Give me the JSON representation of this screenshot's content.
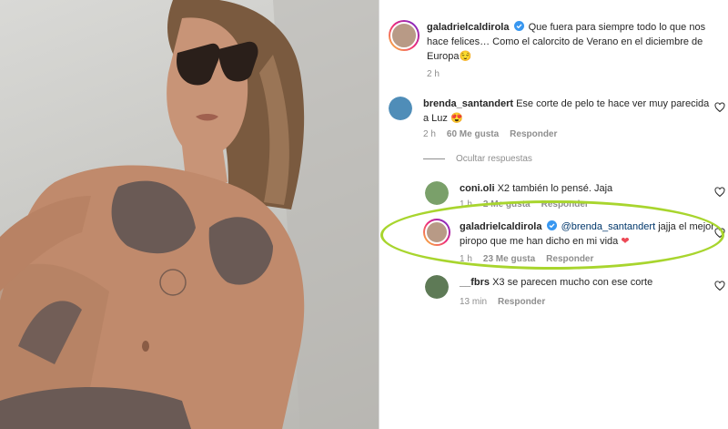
{
  "post": {
    "caption": {
      "username": "galadrielcaldirola",
      "text": "Que fuera para siempre todo lo que nos hace felices… Como el calorcito de Verano en el diciembre de Europa",
      "emoji": "😌",
      "time": "2 h"
    }
  },
  "comments": [
    {
      "username": "brenda_santandert",
      "text": "Ese corte de pelo te hace ver muy parecida a Luz",
      "emoji": "😍",
      "time": "2 h",
      "likes": "60 Me gusta",
      "reply_label": "Responder"
    }
  ],
  "hide_replies_label": "Ocultar respuestas",
  "replies": [
    {
      "username": "coni.oli",
      "text": "X2 también lo pensé. Jaja",
      "time": "1 h",
      "likes": "2 Me gusta",
      "reply_label": "Responder"
    },
    {
      "username": "galadrielcaldirola",
      "mention": "@brenda_santandert",
      "text": "jajja el mejor piropo que me han dicho en mi vida",
      "emoji": "❤",
      "time": "1 h",
      "likes": "23 Me gusta",
      "reply_label": "Responder"
    },
    {
      "username": "__fbrs",
      "text": "X3 se parecen mucho con ese corte",
      "time": "13 min",
      "reply_label": "Responder"
    }
  ],
  "colors": {
    "highlight": "#a8d52e",
    "verified": "#3897f0",
    "heart_red": "#ed4956",
    "mention": "#00376b"
  }
}
